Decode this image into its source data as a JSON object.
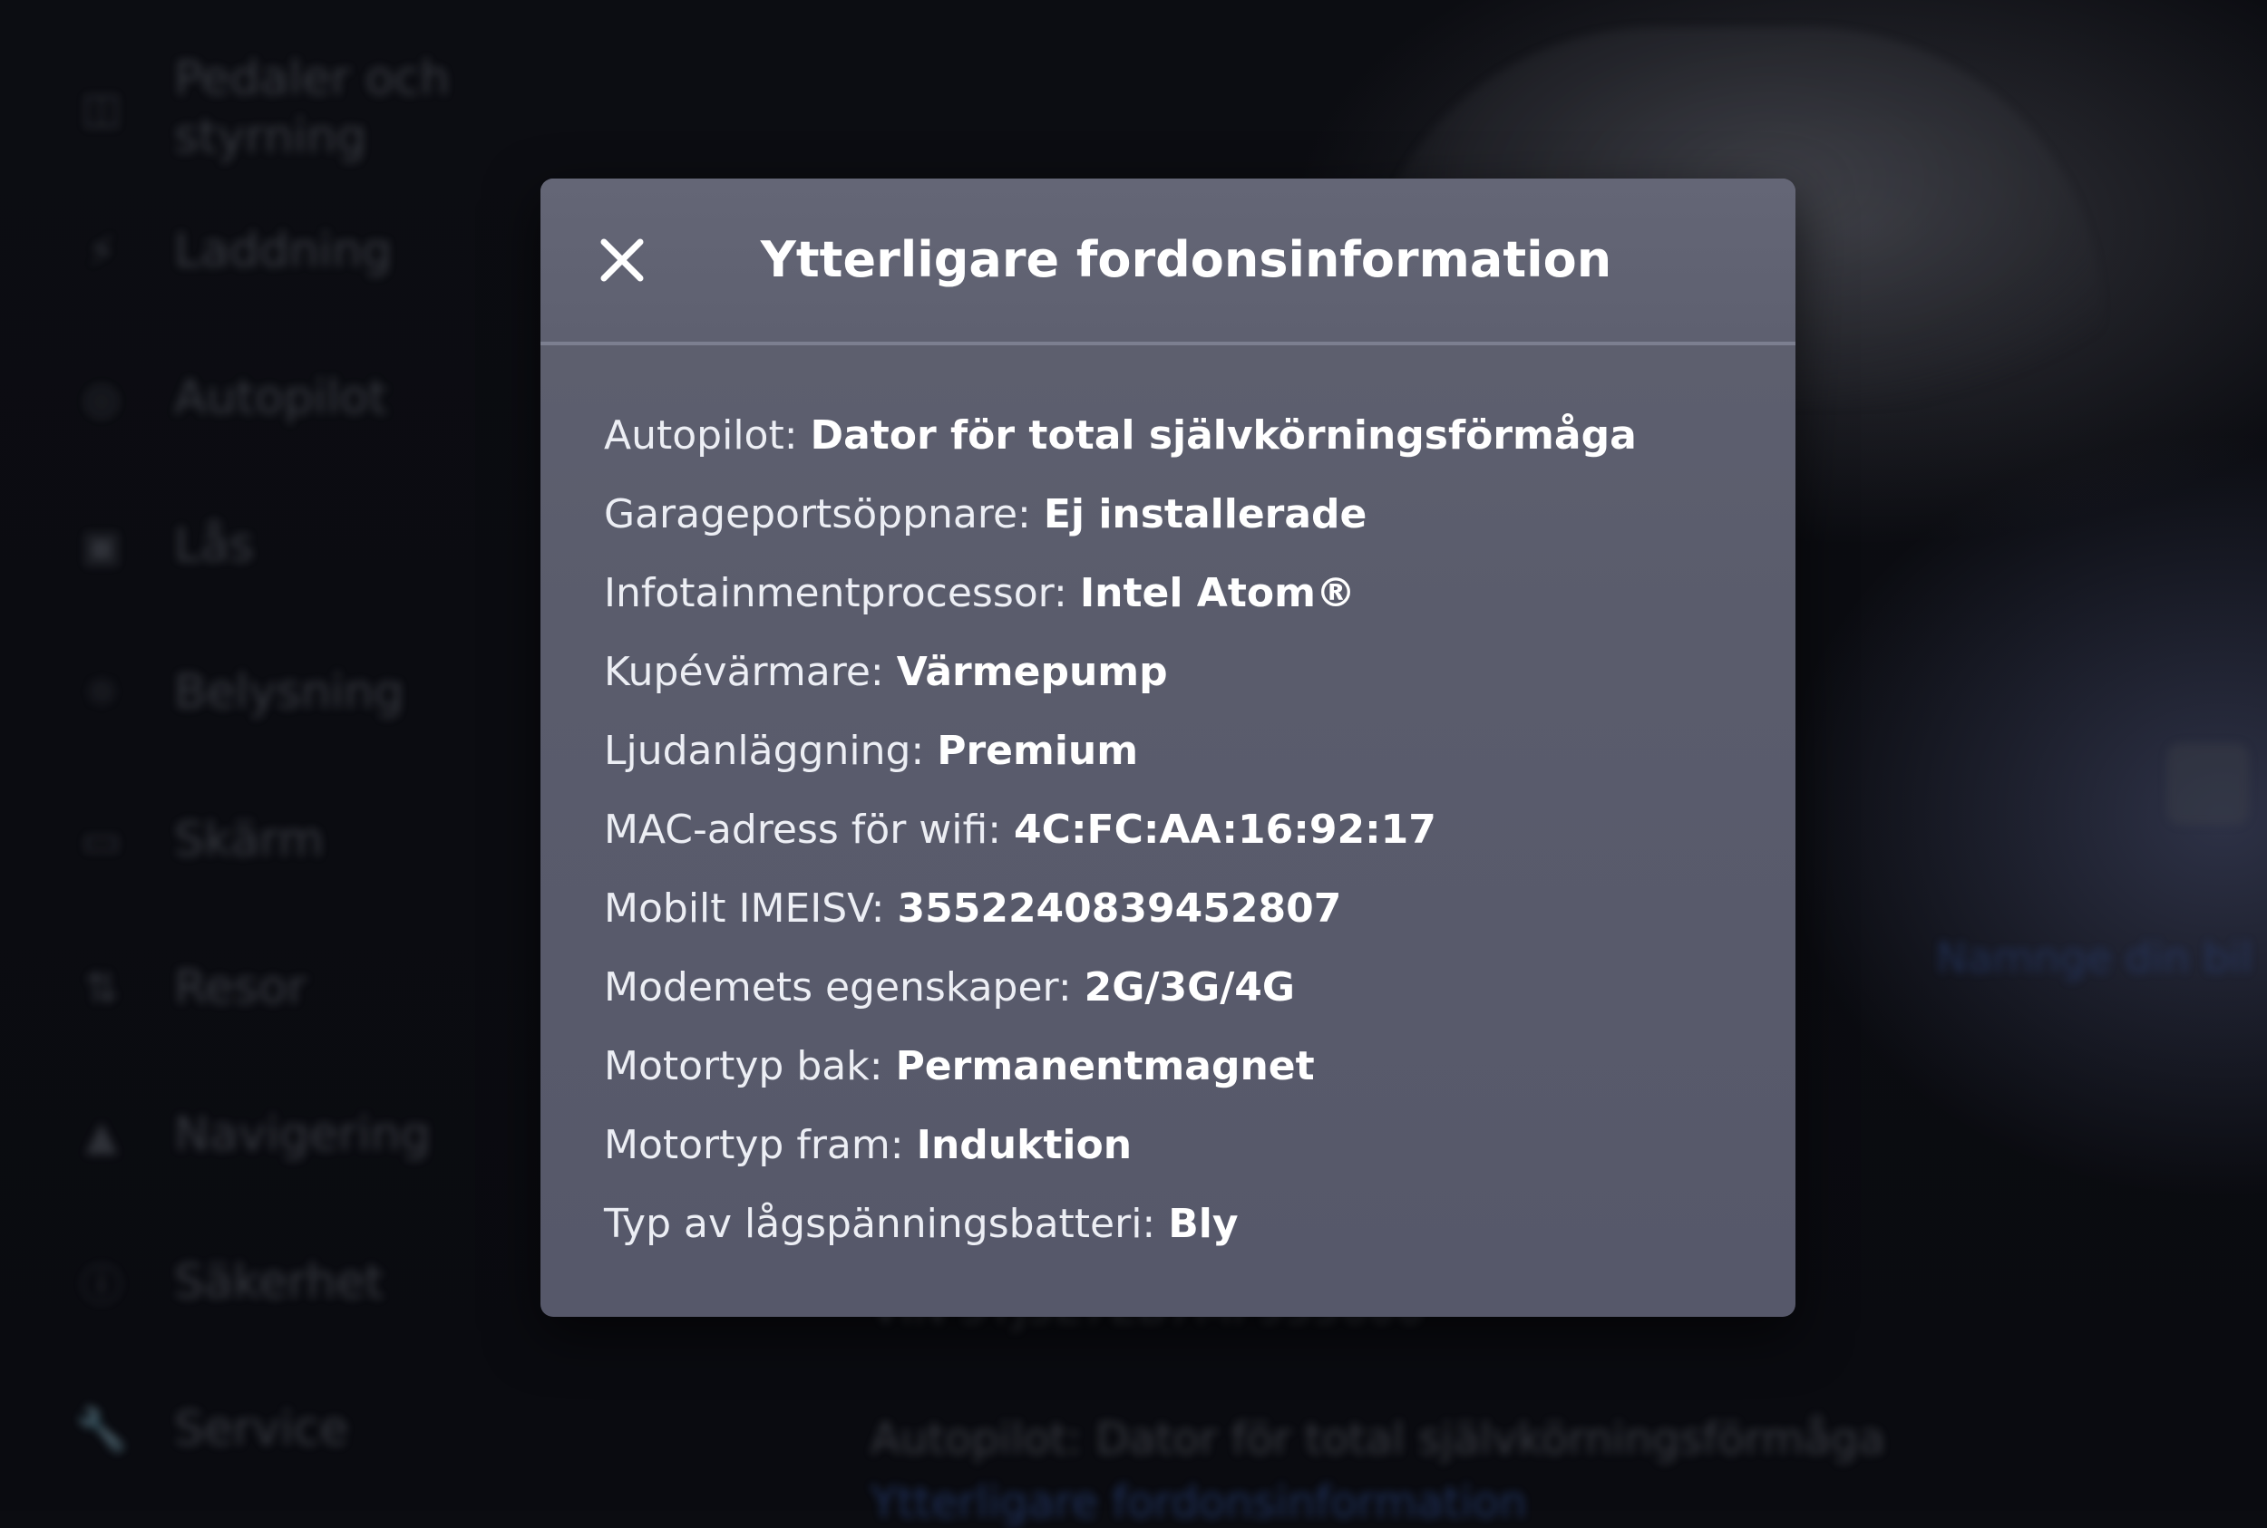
{
  "background": {
    "sidebar_items": [
      {
        "label": "Pedaler och styrning",
        "icon": "car-icon"
      },
      {
        "label": "Laddning",
        "icon": "lightning-icon"
      },
      {
        "label": "Autopilot",
        "icon": "steering-wheel-icon"
      },
      {
        "label": "Lås",
        "icon": "lock-icon"
      },
      {
        "label": "Belysning",
        "icon": "sun-icon"
      },
      {
        "label": "Skärm",
        "icon": "display-icon"
      },
      {
        "label": "Resor",
        "icon": "trips-icon"
      },
      {
        "label": "Navigering",
        "icon": "navigation-icon"
      },
      {
        "label": "Säkerhet",
        "icon": "safety-icon"
      },
      {
        "label": "Service",
        "icon": "wrench-icon"
      }
    ],
    "vin_text": "VIN 5YJ3E7EB7MF955606",
    "autopilot_text": "Autopilot: Dator för total självkörningsförmåga",
    "more_info_link": "Ytterligare fordonsinformation",
    "name_link": "Namnge din bil"
  },
  "modal": {
    "title": "Ytterligare fordonsinformation",
    "close_icon": "close-icon",
    "rows": [
      {
        "key": "Autopilot:",
        "value": "Dator för total självkörningsförmåga"
      },
      {
        "key": "Garageportsöppnare:",
        "value": "Ej installerade"
      },
      {
        "key": "Infotainmentprocessor:",
        "value": "Intel Atom®"
      },
      {
        "key": "Kupévärmare:",
        "value": "Värmepump"
      },
      {
        "key": "Ljudanläggning:",
        "value": "Premium"
      },
      {
        "key": "MAC-adress för wifi:",
        "value": "4C:FC:AA:16:92:17"
      },
      {
        "key": "Mobilt IMEISV:",
        "value": "3552240839452807"
      },
      {
        "key": "Modemets egenskaper:",
        "value": "2G/3G/4G"
      },
      {
        "key": "Motortyp bak:",
        "value": "Permanentmagnet"
      },
      {
        "key": "Motortyp fram:",
        "value": "Induktion"
      },
      {
        "key": "Typ av lågspänningsbatteri:",
        "value": "Bly"
      }
    ]
  }
}
